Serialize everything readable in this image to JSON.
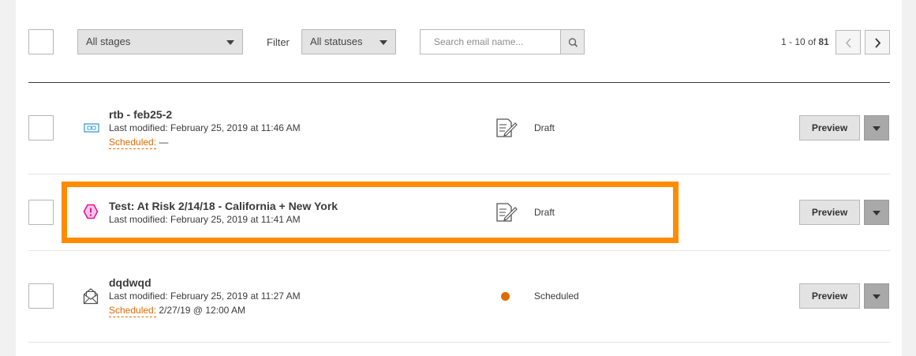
{
  "toolbar": {
    "stage_select": "All stages",
    "filter_label": "Filter",
    "status_select": "All statuses",
    "search_placeholder": "Search email name...",
    "pager_range": "1 - 10 of ",
    "pager_total": "81"
  },
  "emails": [
    {
      "name": "rtb - feb25-2",
      "modified": "Last modified: February 25, 2019 at 11:46 AM",
      "scheduled_label": "Scheduled:",
      "scheduled_value": " —",
      "type_icon": "ticket-icon",
      "status": "Draft",
      "status_icon": "draft-document-icon",
      "preview_label": "Preview"
    },
    {
      "name": "Test: At Risk 2/14/18 - California + New York",
      "modified": "Last modified: February 25, 2019 at 11:41 AM",
      "type_icon": "alert-hexagon-icon",
      "status": "Draft",
      "status_icon": "draft-document-icon",
      "preview_label": "Preview",
      "highlighted": true
    },
    {
      "name": "dqdwqd",
      "modified": "Last modified: February 25, 2019 at 11:27 AM",
      "scheduled_label": "Scheduled:",
      "scheduled_value": " 2/27/19 @ 12:00 AM",
      "type_icon": "open-envelope-icon",
      "status": "Scheduled",
      "status_icon": "scheduled-dot-icon",
      "preview_label": "Preview"
    }
  ],
  "colors": {
    "highlight": "#ff8c00",
    "scheduled_accent": "#e06a00",
    "alert_icon": "#e0179a",
    "ticket_icon": "#4aa3d8"
  }
}
